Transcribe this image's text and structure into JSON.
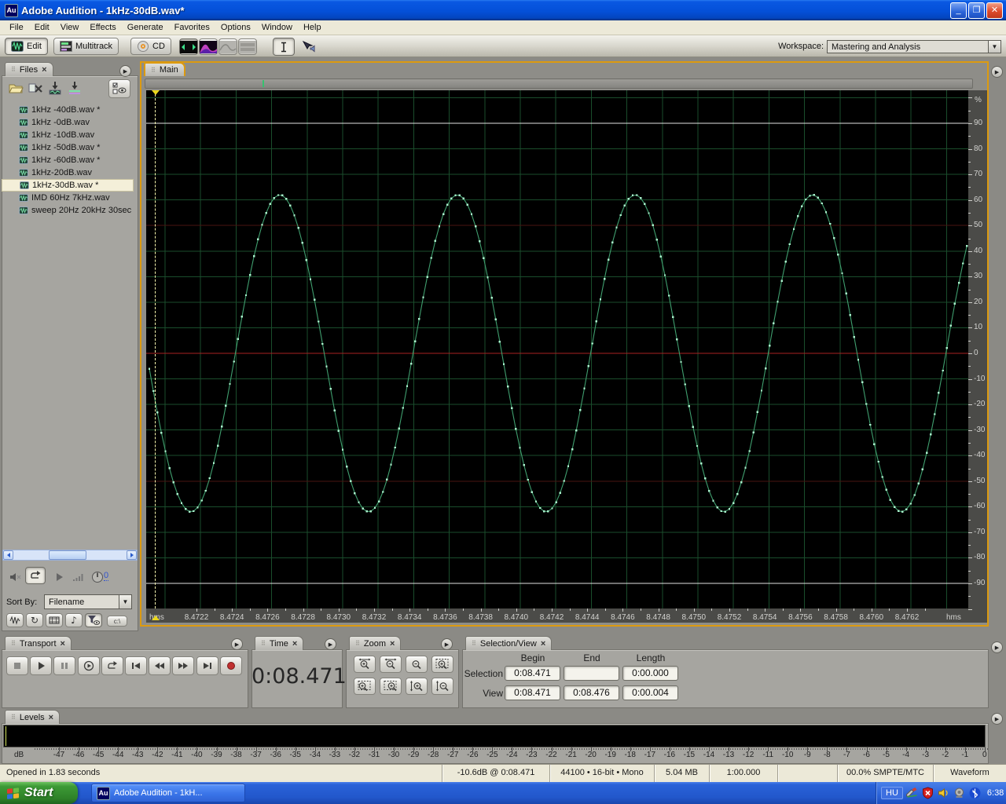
{
  "window": {
    "app_icon_text": "Au",
    "title": "Adobe Audition - 1kHz-30dB.wav*"
  },
  "menu_bar": {
    "items": [
      "File",
      "Edit",
      "View",
      "Effects",
      "Generate",
      "Favorites",
      "Options",
      "Window",
      "Help"
    ]
  },
  "toolbar": {
    "mode_buttons": [
      {
        "label": "Edit",
        "active": true
      },
      {
        "label": "Multitrack",
        "active": false
      },
      {
        "label": "CD",
        "active": false
      }
    ],
    "view_buttons": [
      "waveform-view",
      "spectral-frequency-view",
      "spectral-pan-view",
      "spectral-phase-view"
    ],
    "tool_buttons": [
      "time-selection-tool",
      "scrub-tool"
    ],
    "workspace_label": "Workspace:",
    "workspace_value": "Mastering and Analysis"
  },
  "files_panel": {
    "tab_label": "Files",
    "toolbar_icons": [
      "open-file",
      "close-file",
      "import-file",
      "insert-into-multitrack",
      "advanced-options"
    ],
    "files": [
      "1kHz -40dB.wav *",
      "1kHz -0dB.wav",
      "1kHz -10dB.wav",
      "1kHz -50dB.wav *",
      "1kHz -60dB.wav *",
      "1kHz-20dB.wav",
      "1kHz-30dB.wav *",
      "IMD 60Hz 7kHz.wav",
      "sweep 20Hz 20kHz 30sec"
    ],
    "selected_file": "1kHz-30dB.wav *",
    "preview_controls": [
      "mute-preview",
      "loop-preview",
      "play-preview",
      "preview-volume",
      "preview-level-knob"
    ],
    "preview_knob_value": "0",
    "sort_by_label": "Sort By:",
    "sort_by_value": "Filename",
    "filter_buttons": [
      "show-audio-files",
      "show-loop-files",
      "show-video-files",
      "show-midi-files",
      "filter-options",
      "show-full-paths"
    ]
  },
  "main_panel": {
    "tab_label": "Main",
    "overview_position_fraction": 0.141,
    "time_ruler": {
      "unit_label": "hms",
      "decimals": 4
    },
    "amplitude_ruler": {
      "unit_label": "%",
      "label_max": 90,
      "label_min": -90,
      "label_step": 10
    }
  },
  "chart_data": {
    "type": "line",
    "title": "1 kHz sine tone waveform (Edit View, sample-level zoom)",
    "x_unit": "seconds",
    "x_range": [
      8.471935,
      8.476546
    ],
    "x_ticks": [
      8.4722,
      8.4724,
      8.4726,
      8.4728,
      8.473,
      8.4732,
      8.4734,
      8.4736,
      8.4738,
      8.474,
      8.4742,
      8.4744,
      8.4746,
      8.4748,
      8.475,
      8.4752,
      8.4754,
      8.4756,
      8.4758,
      8.476,
      8.4762
    ],
    "y_unit": "percent amplitude",
    "y_range": [
      -100,
      100
    ],
    "y_grid_step": 10,
    "grid": true,
    "series": [
      {
        "name": "1kHz-30dB.wav",
        "waveform": "sine",
        "frequency_hz": 1000,
        "amplitude_percent": 62,
        "sample_rate_hz": 44100,
        "peak_time_s": 8.4726695
      }
    ],
    "boundary_lines_percent": [
      90,
      -90
    ],
    "center_line_percent": 0,
    "cursor_time_s": 8.471966
  },
  "transport_panel": {
    "tab_label": "Transport",
    "buttons": [
      "stop",
      "play",
      "pause",
      "play-from-cursor",
      "play-looped",
      "go-to-beginning",
      "rewind",
      "fast-forward",
      "go-to-end",
      "record"
    ]
  },
  "time_panel": {
    "tab_label": "Time",
    "value": "0:08.471"
  },
  "zoom_panel": {
    "tab_label": "Zoom",
    "buttons": [
      "zoom-in-horizontally",
      "zoom-out-horizontally",
      "zoom-out-full",
      "zoom-to-selection",
      "zoom-in-to-selection-left",
      "zoom-in-to-selection-right",
      "zoom-in-vertically",
      "zoom-out-vertically"
    ]
  },
  "selection_view_panel": {
    "tab_label": "Selection/View",
    "columns": [
      "Begin",
      "End",
      "Length"
    ],
    "rows": [
      {
        "label": "Selection",
        "begin": "0:08.471",
        "end": "",
        "length": "0:00.000"
      },
      {
        "label": "View",
        "begin": "0:08.471",
        "end": "0:08.476",
        "length": "0:00.004"
      }
    ]
  },
  "levels_panel": {
    "tab_label": "Levels",
    "scale": {
      "unit_label": "dB",
      "min": -47,
      "max": 0,
      "step": 1
    }
  },
  "status_bar": {
    "segments": [
      "Opened in 1.83 seconds",
      "-10.6dB @  0:08.471",
      "44100 • 16-bit • Mono",
      "5.04 MB",
      "1:00.000",
      "",
      "00.0% SMPTE/MTC",
      "Waveform"
    ]
  },
  "taskbar": {
    "start_label": "Start",
    "task_button_label": "Adobe Audition - 1kH...",
    "tray_language": "HU",
    "tray_icons": [
      "tablet-pen",
      "security-alert",
      "volume",
      "audio-device",
      "bluetooth"
    ],
    "clock": "6:38"
  },
  "colors": {
    "titlebar_blue": "#0450d8",
    "menu_bg": "#ece9d8",
    "panel_body": "#a6a5a0",
    "dock_bg": "#8b8a85",
    "focus_border": "#dc9a10",
    "wave_background": "#000000",
    "wave_grid_green": "#1a4d2c",
    "wave_line_green": "#3f9e6e",
    "wave_sample_dot": "#aaf0cc",
    "center_line_red": "#a82222",
    "half_line_red": "#4a1410",
    "boundary_line_white": "#e2e2e2",
    "cursor_yellow": "#ead81c",
    "record_red": "#c03030",
    "taskbar_blue": "#2a62d8",
    "start_green": "#2e8128",
    "selected_file_bg": "#f4efd9"
  }
}
